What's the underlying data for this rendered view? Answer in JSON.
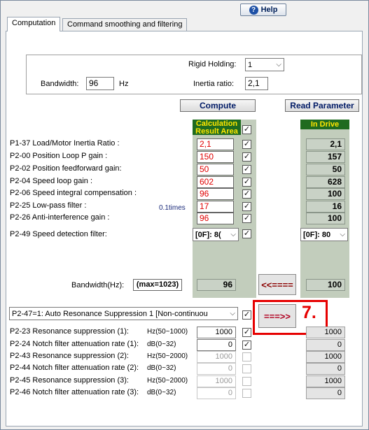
{
  "help": {
    "label": "Help",
    "icon": "question-icon"
  },
  "tabs": [
    {
      "label": "Computation",
      "active": true
    },
    {
      "label": "Command smoothing and filtering",
      "active": false
    }
  ],
  "settings": {
    "rigid_holding_label": "Rigid Holding:",
    "rigid_holding_value": "1",
    "bandwidth_label": "Bandwidth:",
    "bandwidth_value": "96",
    "bandwidth_unit": "Hz",
    "inertia_label": "Inertia ratio:",
    "inertia_value": "2,1"
  },
  "buttons": {
    "compute": "Compute",
    "read_parameter": "Read Parameter"
  },
  "columns": {
    "calc_header": "Calculation Result Area",
    "drive_header": "In Drive"
  },
  "params": [
    {
      "label": "P1-37 Load/Motor Inertia Ratio :",
      "calc": "2,1",
      "drive": "2,1"
    },
    {
      "label": "P2-00 Position Loop P gain :",
      "calc": "150",
      "drive": "157"
    },
    {
      "label": "P2-02 Position feedforward gain:",
      "calc": "50",
      "drive": "50"
    },
    {
      "label": "P2-04 Speed loop gain :",
      "calc": "602",
      "drive": "628"
    },
    {
      "label": "P2-06 Speed integral compensation :",
      "calc": "96",
      "drive": "100"
    },
    {
      "label": "P2-25 Low-pass filter :",
      "calc": "17",
      "drive": "16",
      "unit": "0.1times"
    },
    {
      "label": "P2-26 Anti-interference gain :",
      "calc": "96",
      "drive": "100"
    }
  ],
  "speed_filter": {
    "label": "P2-49 Speed detection filter:",
    "calc": "[0F]: 8(",
    "drive": "[0F]: 80"
  },
  "bandwidth_row": {
    "label": "Bandwidth(Hz):",
    "max": "(max=1023)",
    "calc": "96",
    "drive": "100",
    "left_arrow": "<<===="
  },
  "resonance": {
    "mode": "P2-47=1: Auto Resonance Suppression 1 [Non-continuou",
    "right_arrow": "===>>",
    "annotation": "7.",
    "rows": [
      {
        "label": "P2-23 Resonance suppression (1):",
        "range": "Hz(50~1000)",
        "calc": "1000",
        "drive": "1000",
        "enabled": true,
        "checked": true
      },
      {
        "label": "P2-24 Notch filter attenuation rate (1):",
        "range": "dB(0~32)",
        "calc": "0",
        "drive": "0",
        "enabled": true,
        "checked": true
      },
      {
        "label": "P2-43 Resonance suppression (2):",
        "range": "Hz(50~2000)",
        "calc": "1000",
        "drive": "1000",
        "enabled": false,
        "checked": false
      },
      {
        "label": "P2-44 Notch filter attenuation rate (2):",
        "range": "dB(0~32)",
        "calc": "0",
        "drive": "0",
        "enabled": false,
        "checked": false
      },
      {
        "label": "P2-45 Resonance suppression (3):",
        "range": "Hz(50~2000)",
        "calc": "1000",
        "drive": "1000",
        "enabled": false,
        "checked": false
      },
      {
        "label": "P2-46 Notch filter attenuation rate (3):",
        "range": "dB(0~32)",
        "calc": "0",
        "drive": "0",
        "enabled": false,
        "checked": false
      }
    ]
  },
  "check_mark": "✓",
  "chevron": "⌵",
  "colors": {
    "calc_value": "#e00000",
    "header_bg": "#1f6b1f",
    "header_text": "#ffe600",
    "annotation": "#e60000",
    "arrow": "#8b0000"
  }
}
